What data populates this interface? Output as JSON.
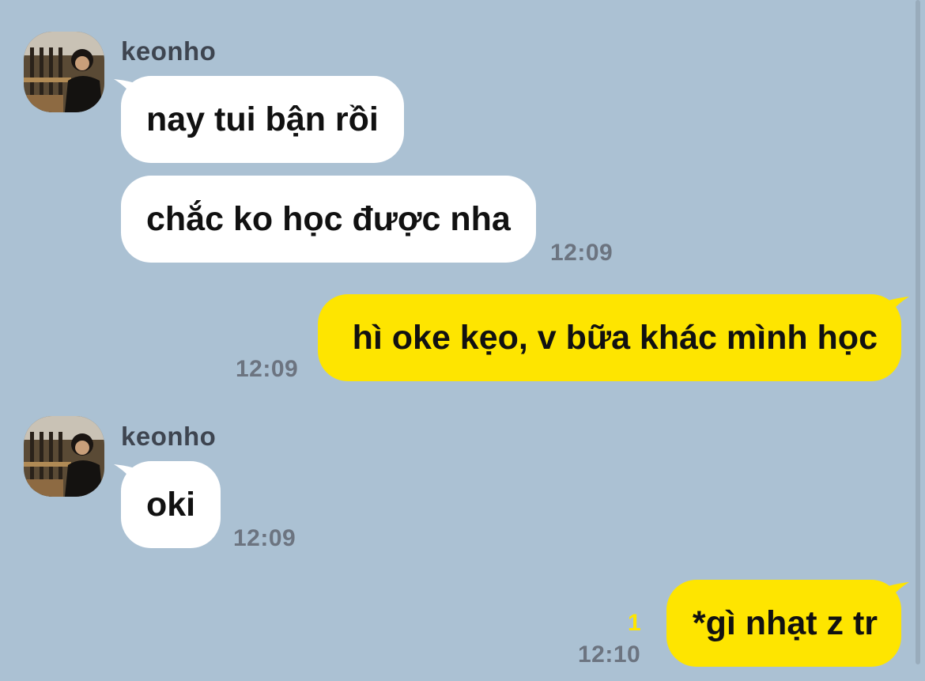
{
  "colors": {
    "background": "#abc1d3",
    "incoming_bubble": "#ffffff",
    "outgoing_bubble": "#fee500",
    "time_text": "#6c7480",
    "unread_count": "#fee500"
  },
  "groups": [
    {
      "sender": "keonho",
      "avatar_icon": "profile-photo-icon",
      "messages": [
        "nay tui bận rồi",
        "chắc ko học được nha"
      ],
      "time": "12:09"
    },
    {
      "outgoing": true,
      "message": "hì oke kẹo, v bữa khác mình học",
      "time": "12:09"
    },
    {
      "sender": "keonho",
      "avatar_icon": "profile-photo-icon",
      "messages": [
        "oki"
      ],
      "time": "12:09"
    },
    {
      "outgoing": true,
      "message": "*gì nhạt z tr",
      "time": "12:10",
      "unread": "1"
    }
  ]
}
